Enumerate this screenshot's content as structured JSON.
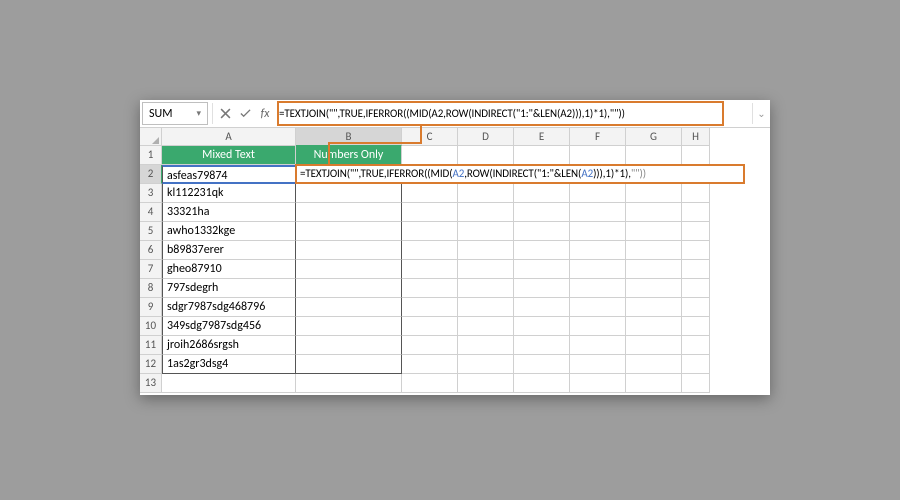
{
  "namebox": {
    "value": "SUM"
  },
  "formula_bar": "=TEXTJOIN(\"\",TRUE,IFERROR((MID(A2,ROW(INDIRECT(\"1:\"&LEN(A2))),1)*1),\"\"))",
  "columns": [
    "A",
    "B",
    "C",
    "D",
    "E",
    "F",
    "G",
    "H"
  ],
  "headers": {
    "A": "Mixed Text",
    "B": "Numbers Only"
  },
  "rows": [
    {
      "n": 1,
      "a": "",
      "isHeader": true
    },
    {
      "n": 2,
      "a": "asfeas79874"
    },
    {
      "n": 3,
      "a": "kl112231qk"
    },
    {
      "n": 4,
      "a": "33321ha"
    },
    {
      "n": 5,
      "a": "awho1332kge"
    },
    {
      "n": 6,
      "a": "b89837erer"
    },
    {
      "n": 7,
      "a": "gheo87910"
    },
    {
      "n": 8,
      "a": "797sdegrh"
    },
    {
      "n": 9,
      "a": "sdgr7987sdg468796"
    },
    {
      "n": 10,
      "a": "349sdg7987sdg456"
    },
    {
      "n": 11,
      "a": "jroih2686srgsh"
    },
    {
      "n": 12,
      "a": "1as2gr3dsg4"
    },
    {
      "n": 13,
      "a": ""
    }
  ],
  "active": {
    "row": 2,
    "col": "B"
  },
  "cell_formula": {
    "pre": "=TEXTJOIN(\"\",TRUE,IFERROR((MID(",
    "ref1": "A2",
    "mid1": ",ROW(INDIRECT(\"1:\"&LEN(",
    "ref2": "A2",
    "mid2": "))),1)*1),",
    "tail": "\"\"))"
  },
  "fx_label": "fx"
}
